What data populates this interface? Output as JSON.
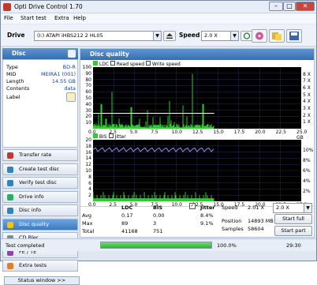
{
  "window": {
    "title": "Opti Drive Control 1.70"
  },
  "menu": [
    "File",
    "Start test",
    "Extra",
    "Help"
  ],
  "toolbar": {
    "drive_label": "Drive",
    "drive_value": "(I:)   ATAPI iHBS212   2 HL05",
    "speed_label": "Speed",
    "speed_value": "2.0 X"
  },
  "disc": {
    "header": "Disc",
    "rows": [
      {
        "k": "Type",
        "v": "BD-R"
      },
      {
        "k": "MID",
        "v": "MEIRA1 (001)"
      },
      {
        "k": "Length",
        "v": "14.55 GB"
      },
      {
        "k": "Contents",
        "v": "data"
      },
      {
        "k": "Label",
        "v": ""
      }
    ]
  },
  "nav": [
    {
      "label": "Transfer rate",
      "icon": "transfer-rate-icon",
      "color": "#c0392b"
    },
    {
      "label": "Create test disc",
      "icon": "create-disc-icon",
      "color": "#2e86c1"
    },
    {
      "label": "Verify test disc",
      "icon": "verify-disc-icon",
      "color": "#2e86c1"
    },
    {
      "label": "Drive info",
      "icon": "drive-info-icon",
      "color": "#27ae60"
    },
    {
      "label": "Disc info",
      "icon": "disc-info-icon",
      "color": "#2e86c1"
    },
    {
      "label": "Disc quality",
      "icon": "disc-quality-icon",
      "color": "#f1c40f"
    },
    {
      "label": "CD Bler",
      "icon": "cd-bler-icon",
      "color": "#7f8c8d"
    },
    {
      "label": "FE / TE",
      "icon": "fe-te-icon",
      "color": "#8e44ad"
    },
    {
      "label": "Extra tests",
      "icon": "extra-tests-icon",
      "color": "#e67e22"
    }
  ],
  "status_window_label": "Status window >>",
  "panel_title": "Disc quality",
  "legend1": {
    "ldc": "LDC",
    "rest": "Read speed",
    "ws": "Write speed"
  },
  "legend2": {
    "bis": "BIS",
    "jitter": "Jitter"
  },
  "xticks": [
    "0.0",
    "2.5",
    "5.0",
    "7.5",
    "10.0",
    "12.5",
    "15.0",
    "17.5",
    "20.0",
    "22.5",
    "25.0 GB"
  ],
  "chart_data": [
    {
      "type": "bar",
      "title": "LDC / Read speed / Write speed",
      "x_label": "GB",
      "xlim": [
        0,
        25
      ],
      "y_left_ticks": [
        "100",
        "90",
        "80",
        "70",
        "60",
        "50",
        "40",
        "30",
        "20",
        "10"
      ],
      "y_right_ticks": [
        "8 X",
        "7 X",
        "6 X",
        "5 X",
        "4 X",
        "3 X",
        "2 X",
        "1 X"
      ],
      "ylim": [
        0,
        100
      ],
      "series": [
        {
          "name": "LDC",
          "color": "#2ecc2e",
          "typical": 5,
          "peaks": [
            [
              1.0,
              40
            ],
            [
              2.3,
              60
            ],
            [
              4.6,
              35
            ],
            [
              6.5,
              30
            ],
            [
              9.2,
              45
            ],
            [
              10.8,
              38
            ],
            [
              11.9,
              89
            ],
            [
              13.2,
              40
            ]
          ]
        },
        {
          "name": "Read speed",
          "color": "#ffffff",
          "value_x": 2.0
        }
      ],
      "data_end_gb": 14.55
    },
    {
      "type": "bar",
      "title": "BIS / Jitter",
      "xlim": [
        0,
        25
      ],
      "y_left_ticks": [
        "20",
        "18",
        "16",
        "14",
        "12",
        "10",
        "8",
        "6",
        "4",
        "2"
      ],
      "y_right_ticks": [
        "10%",
        "8%",
        "6%",
        "4%",
        "2%"
      ],
      "ylim": [
        0,
        20
      ],
      "series": [
        {
          "name": "BIS",
          "color": "#2ecc2e",
          "typical": 1,
          "max": 3
        },
        {
          "name": "Jitter",
          "color": "#9b8cf0",
          "avg_pct": 8.4,
          "max_pct": 9.1
        }
      ]
    }
  ],
  "stats": {
    "headers": [
      "LDC",
      "BIS"
    ],
    "jitter_label": "Jitter",
    "rows": [
      {
        "label": "Avg",
        "ldc": "0.17",
        "bis": "0.00",
        "jitter": "8.4%"
      },
      {
        "label": "Max",
        "ldc": "89",
        "bis": "3",
        "jitter": "9.1%"
      },
      {
        "label": "Total",
        "ldc": "41168",
        "bis": "751",
        "jitter": ""
      }
    ],
    "speed_label": "Speed",
    "speed_value": "2.01 X",
    "speed_select": "2.0 X",
    "position_label": "Position",
    "position_value": "14893 MB",
    "samples_label": "Samples",
    "samples_value": "58604",
    "start_full": "Start full",
    "start_part": "Start part"
  },
  "statusbar": {
    "text": "Test completed",
    "progress": "100.0%",
    "progress_value": 1.0,
    "time": "29:30"
  }
}
